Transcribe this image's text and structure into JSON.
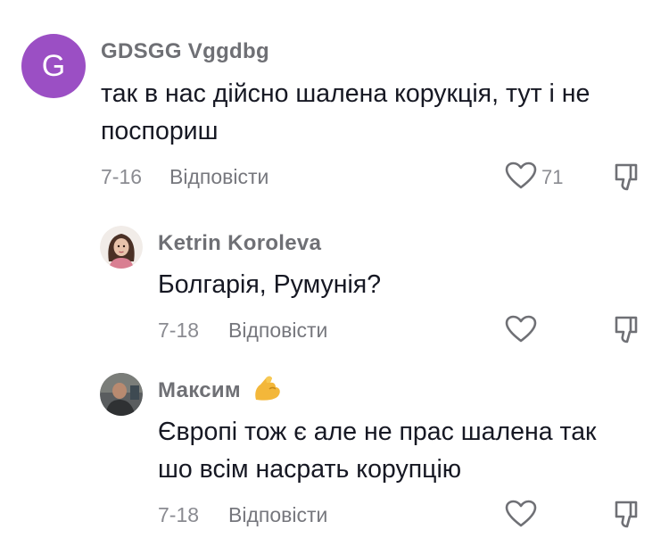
{
  "comments": [
    {
      "avatar_letter": "G",
      "avatar_color": "#9b4fc4",
      "username": "GDSGG Vggdbg",
      "text_lines": [
        "так в нас дійсно шалена корукція, тут і не",
        "поспориш"
      ],
      "date": "7-16",
      "reply_label": "Відповісти",
      "likes": "71"
    },
    {
      "username": "Ketrin Koroleva",
      "text_lines": [
        "Болгарія, Румунія?"
      ],
      "date": "7-18",
      "reply_label": "Відповісти"
    },
    {
      "username": "Максим",
      "username_emoji": "flexed-biceps",
      "text_lines": [
        "Європі тож є але не прас шалена так",
        "шо всім насрать корупцію"
      ],
      "date": "7-18",
      "reply_label": "Відповісти"
    }
  ]
}
